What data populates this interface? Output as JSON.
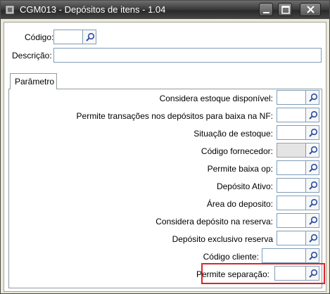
{
  "window": {
    "title": "CGM013 - Depósitos de itens - 1.04"
  },
  "header": {
    "codigo_label": "Código:",
    "codigo_value": "",
    "descricao_label": "Descrição:",
    "descricao_value": ""
  },
  "tabs": [
    {
      "label": "Parâmetro"
    }
  ],
  "params": [
    {
      "label": "Considera estoque disponível:",
      "value": ""
    },
    {
      "label": "Permite transações nos depósitos para baixa na NF:",
      "value": ""
    },
    {
      "label": "Situação de estoque:",
      "value": ""
    },
    {
      "label": "Código fornecedor:",
      "value": ""
    },
    {
      "label": "Permite baixa op:",
      "value": ""
    },
    {
      "label": "Depósito Ativo:",
      "value": ""
    },
    {
      "label": "Área do deposito:",
      "value": ""
    },
    {
      "label": "Considera depósito na reserva:",
      "value": ""
    },
    {
      "label": "Depósito exclusivo reserva",
      "value": ""
    },
    {
      "label": "Código cliente:",
      "value": ""
    },
    {
      "label": "Permite separação:",
      "value": ""
    }
  ],
  "colors": {
    "highlight": "#d9252a"
  },
  "icons": {
    "search": "magnifier-icon"
  }
}
